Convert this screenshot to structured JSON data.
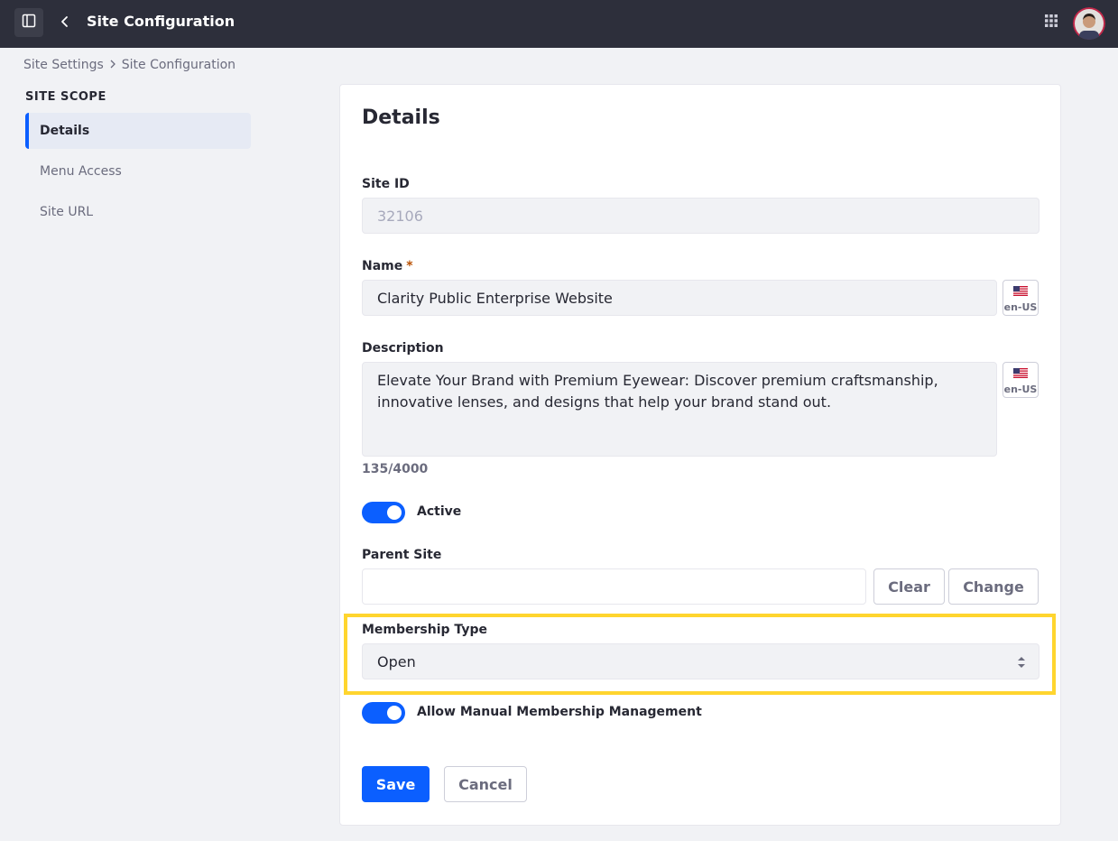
{
  "topbar": {
    "title": "Site Configuration"
  },
  "breadcrumb": {
    "items": [
      "Site Settings",
      "Site Configuration"
    ]
  },
  "sidebar": {
    "section_title": "SITE SCOPE",
    "items": [
      {
        "label": "Details",
        "active": true
      },
      {
        "label": "Menu Access",
        "active": false
      },
      {
        "label": "Site URL",
        "active": false
      }
    ]
  },
  "form": {
    "title": "Details",
    "site_id": {
      "label": "Site ID",
      "value": "32106"
    },
    "name": {
      "label": "Name",
      "required_mark": "*",
      "value": "Clarity Public Enterprise Website",
      "locale": "en-US"
    },
    "description": {
      "label": "Description",
      "value": "Elevate Your Brand with Premium Eyewear: Discover premium craftsmanship, innovative lenses, and designs that help your brand stand out.",
      "locale": "en-US",
      "counter": "135/4000"
    },
    "active": {
      "label": "Active",
      "on": true
    },
    "parent_site": {
      "label": "Parent Site",
      "value": "",
      "clear_label": "Clear",
      "change_label": "Change"
    },
    "membership_type": {
      "label": "Membership Type",
      "selected": "Open"
    },
    "manual_membership": {
      "label": "Allow Manual Membership Management",
      "on": true
    },
    "save_label": "Save",
    "cancel_label": "Cancel"
  },
  "colors": {
    "topbar": "#2d2f3b",
    "primary": "#0b5fff",
    "highlight": "#ffd52e",
    "required": "#b95000"
  }
}
